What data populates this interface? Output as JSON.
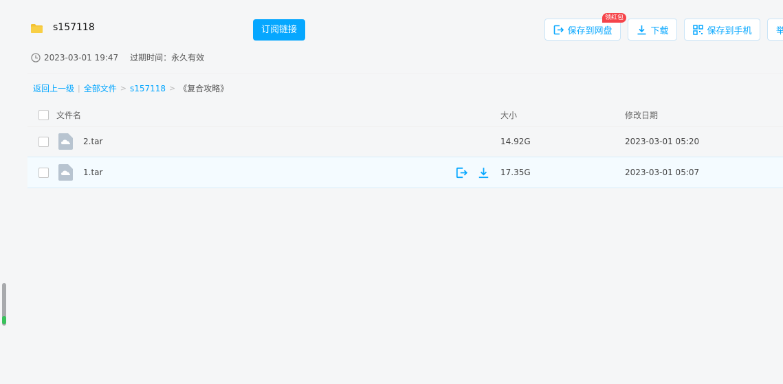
{
  "share": {
    "folder_name": "s157118",
    "subscribe_label": "订阅链接",
    "created_at": "2023-03-01 19:47",
    "expire_label": "过期时间：永久有效"
  },
  "toolbar": {
    "save_to_disk": "保存到网盘",
    "red_packet_badge": "领红包",
    "download": "下载",
    "save_to_phone": "保存到手机",
    "report_partial": "举"
  },
  "breadcrumb": {
    "back": "返回上一级",
    "divider": "|",
    "all_files": "全部文件",
    "sep1": ">",
    "folder": "s157118",
    "sep2": ">",
    "current": "《复合攻略》"
  },
  "table": {
    "headers": {
      "name": "文件名",
      "size": "大小",
      "modified": "修改日期"
    },
    "rows": [
      {
        "name": "2.tar",
        "size": "14.92G",
        "modified": "2023-03-01 05:20"
      },
      {
        "name": "1.tar",
        "size": "17.35G",
        "modified": "2023-03-01 05:07"
      }
    ]
  },
  "colors": {
    "accent": "#06a7ff",
    "badge": "#f5444a",
    "folder": "#f3c233"
  },
  "icons": [
    "folder-icon",
    "clock-icon",
    "save-icon",
    "download-icon",
    "qrcode-icon",
    "file-cloud-icon"
  ]
}
